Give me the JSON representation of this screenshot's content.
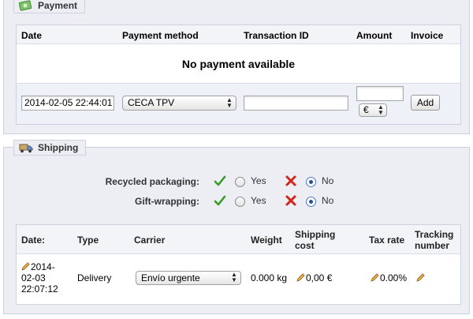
{
  "payment": {
    "legend": "Payment",
    "icon": "money-icon",
    "columns": [
      "Date",
      "Payment method",
      "Transaction ID",
      "Amount",
      "Invoice"
    ],
    "empty_message": "No payment available",
    "form": {
      "date_value": "2014-02-05 22:44:01",
      "method_value": "CECA TPV",
      "transaction_value": "",
      "amount_value": "",
      "currency_value": "€",
      "add_label": "Add"
    }
  },
  "shipping": {
    "legend": "Shipping",
    "icon": "truck-icon",
    "options": [
      {
        "label": "Recycled packaging:",
        "yes": "Yes",
        "no": "No",
        "selected": "no"
      },
      {
        "label": "Gift-wrapping:",
        "yes": "Yes",
        "no": "No",
        "selected": "no"
      }
    ],
    "columns": {
      "date": "Date:",
      "type": "Type",
      "carrier": "Carrier",
      "weight": "Weight",
      "shipping_cost_1": "Shipping",
      "shipping_cost_2": "cost",
      "tax_rate": "Tax rate",
      "tracking_1": "Tracking",
      "tracking_2": "number"
    },
    "row": {
      "date_1": "2014-",
      "date_2": "02-03",
      "date_3": "22:07:12",
      "type": "Delivery",
      "carrier": "Envío urgente",
      "weight": "0.000 kg",
      "shipping_cost": "0,00 €",
      "tax_rate": "0.00%",
      "tracking_number": ""
    }
  },
  "colors": {
    "panel_bg": "#eceef3",
    "border": "#cdd3de",
    "check_green": "#3a9a2a",
    "cross_red": "#d2261c"
  }
}
